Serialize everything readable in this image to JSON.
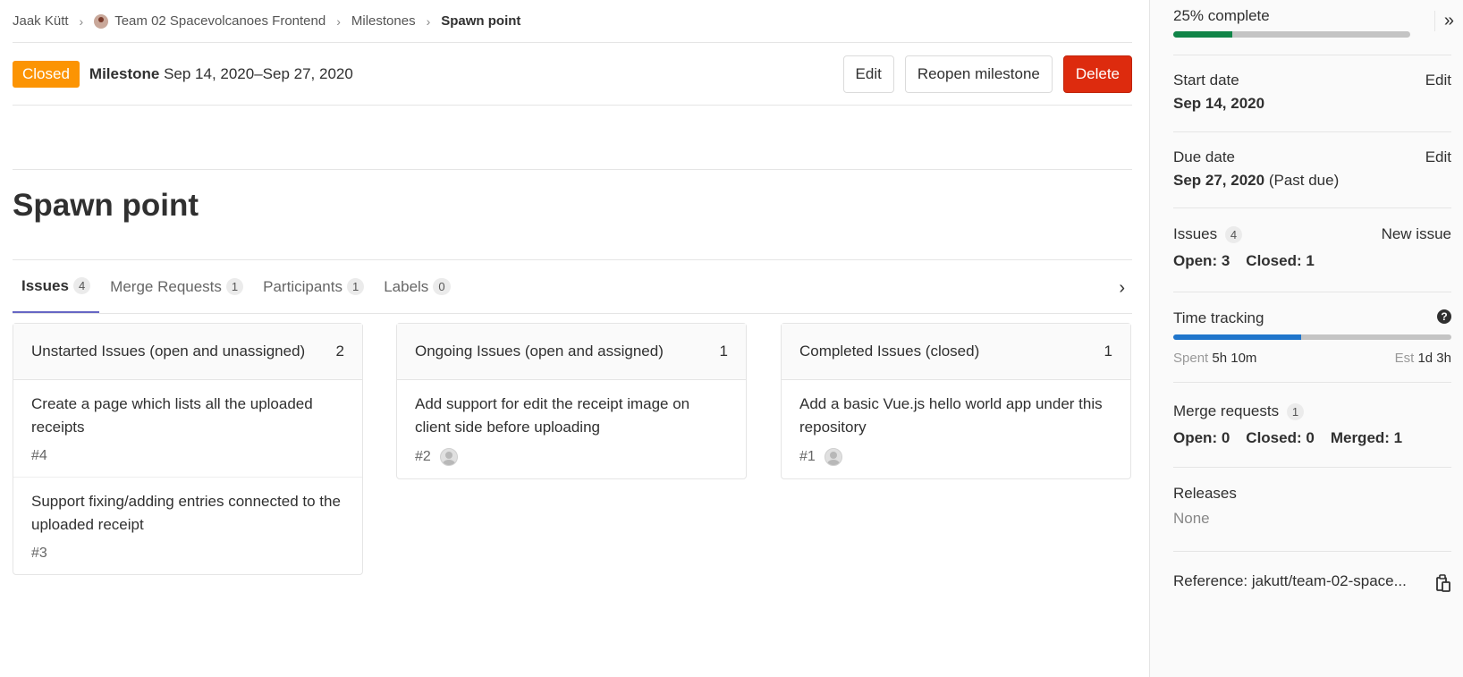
{
  "breadcrumb": {
    "user": "Jaak Kütt",
    "project": "Team 02 Spacevolcanoes Frontend",
    "section": "Milestones",
    "current": "Spawn point"
  },
  "header": {
    "status": "Closed",
    "label": "Milestone",
    "dates": "Sep 14, 2020–Sep 27, 2020",
    "edit": "Edit",
    "reopen": "Reopen milestone",
    "delete": "Delete"
  },
  "title": "Spawn point",
  "tabs": [
    {
      "label": "Issues",
      "count": "4"
    },
    {
      "label": "Merge Requests",
      "count": "1"
    },
    {
      "label": "Participants",
      "count": "1"
    },
    {
      "label": "Labels",
      "count": "0"
    }
  ],
  "boards": [
    {
      "title": "Unstarted Issues (open and unassigned)",
      "count": "2",
      "issues": [
        {
          "title": "Create a page which lists all the uploaded receipts",
          "ref": "#4",
          "assignee": false
        },
        {
          "title": "Support fixing/adding entries connected to the uploaded receipt",
          "ref": "#3",
          "assignee": false
        }
      ]
    },
    {
      "title": "Ongoing Issues (open and assigned)",
      "count": "1",
      "issues": [
        {
          "title": "Add support for edit the receipt image on client side before uploading",
          "ref": "#2",
          "assignee": true
        }
      ]
    },
    {
      "title": "Completed Issues (closed)",
      "count": "1",
      "issues": [
        {
          "title": "Add a basic Vue.js hello world app under this repository",
          "ref": "#1",
          "assignee": true
        }
      ]
    }
  ],
  "sidebar": {
    "progress_label": "25% complete",
    "progress": 0.25,
    "progress_color": "#108548",
    "start_date_label": "Start date",
    "start_date": "Sep 14, 2020",
    "due_date_label": "Due date",
    "due_date": "Sep 27, 2020",
    "due_note": "(Past due)",
    "edit": "Edit",
    "issues_label": "Issues",
    "issues_count": "4",
    "new_issue": "New issue",
    "issues_open": "Open: 3",
    "issues_closed": "Closed: 1",
    "time_tracking_label": "Time tracking",
    "time_progress": 0.46,
    "time_color": "#1f75cb",
    "spent_label": "Spent",
    "spent": "5h 10m",
    "est_label": "Est",
    "est": "1d 3h",
    "mr_label": "Merge requests",
    "mr_count": "1",
    "mr_open": "Open: 0",
    "mr_closed": "Closed: 0",
    "mr_merged": "Merged: 1",
    "releases_label": "Releases",
    "releases_value": "None",
    "reference": "Reference: jakutt/team-02-space..."
  },
  "colors": {
    "closed_badge": "#fc9403",
    "delete_button": "#dd2b0e",
    "active_tab": "#6666c4"
  },
  "icons": {
    "breadcrumb_sep": "chevron-right-icon",
    "collapse": "double-chevron-right-icon",
    "tab_scroll": "chevron-right-icon",
    "help": "question-circle-icon",
    "copy": "clipboard-icon"
  }
}
